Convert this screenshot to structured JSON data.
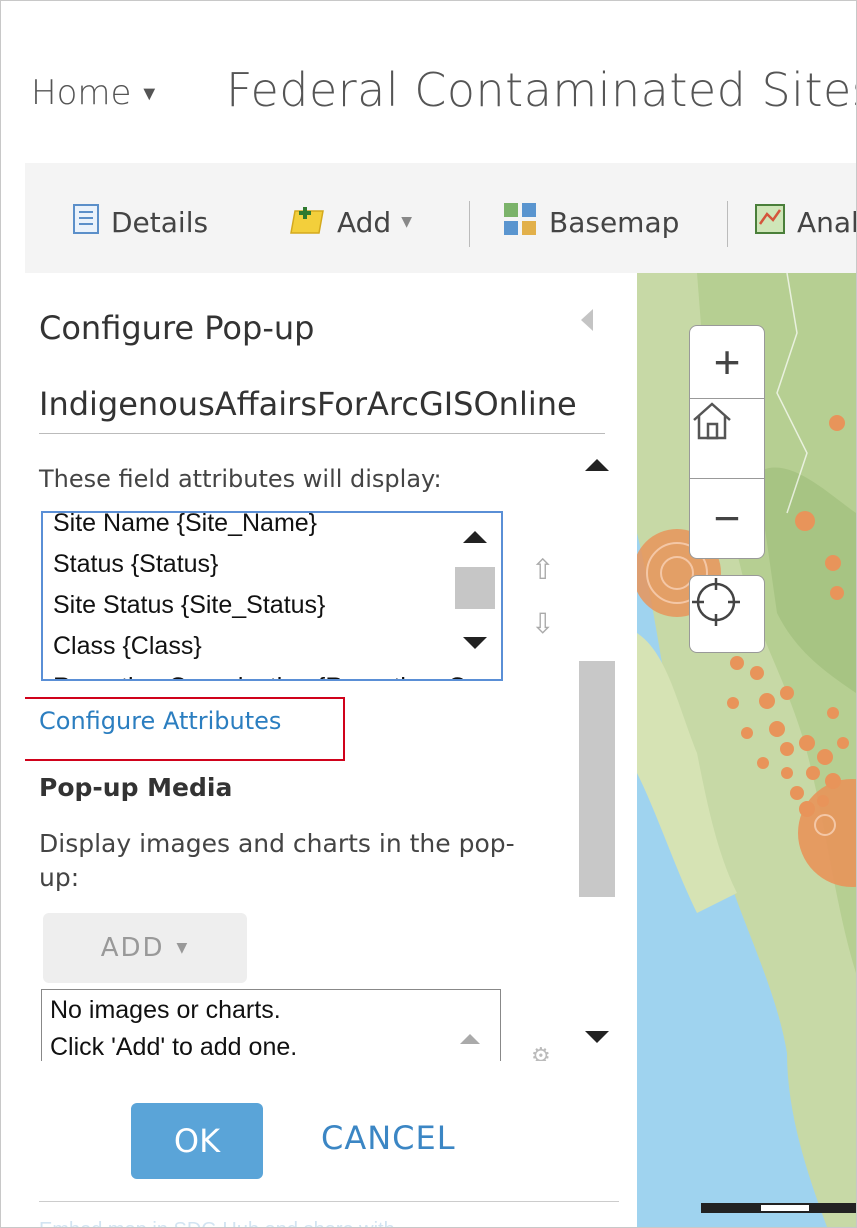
{
  "header": {
    "home_label": "Home",
    "map_title": "Federal Contaminated Sites"
  },
  "toolbar": {
    "details_label": "Details",
    "add_label": "Add",
    "basemap_label": "Basemap",
    "analysis_label": "Analysis"
  },
  "panel": {
    "title": "Configure Pop-up",
    "layer_name": "IndigenousAffairsForArcGISOnline",
    "field_attributes_label": "These field attributes will display:",
    "field_list": [
      "Site Name {Site_Name}",
      "Status {Status}",
      "Site Status {Site_Status}",
      "Class {Class}",
      "Reporting Organization {Reporting_Organization}"
    ],
    "configure_attributes_link": "Configure Attributes",
    "popup_media_heading": "Pop-up Media",
    "popup_media_description": "Display images and charts in the pop-up:",
    "add_media_label": "ADD",
    "media_list": [
      "No images or charts.",
      "Click 'Add' to add one."
    ],
    "ok_label": "OK",
    "cancel_label": "CANCEL",
    "footer_text": "Embed map in SDG Hub and share with..."
  },
  "colors": {
    "accent": "#5aa4d8",
    "link": "#2b7ec0",
    "highlight": "#d0021b",
    "site_marker": "#e8945a"
  }
}
